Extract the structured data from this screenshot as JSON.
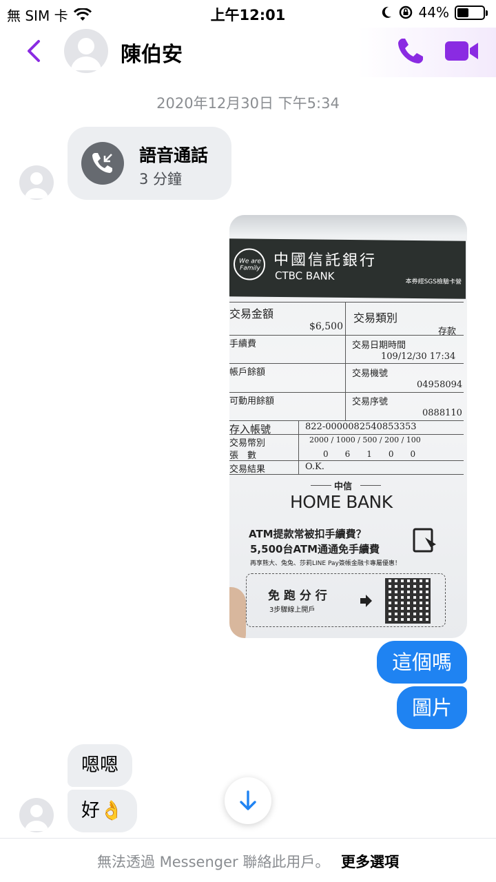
{
  "status_bar": {
    "carrier": "無 SIM 卡",
    "time": "上午12:01",
    "battery": "44%",
    "battery_level": 0.44
  },
  "header": {
    "contact_name": "陳伯安",
    "accent_color": "#8a2be2"
  },
  "conversation": {
    "timestamp": "2020年12月30日 下午5:34",
    "voice_call": {
      "title": "語音通話",
      "duration": "3 分鐘"
    },
    "receipt_photo": {
      "bank_name_zh": "中國信託銀行",
      "bank_name_en": "CTBC BANK",
      "banner_note": "本券經SGS檢驗卡營",
      "logo_text": "We are Family",
      "amount_label": "交易金額",
      "amount": "$6,500",
      "type_label": "交易類別",
      "type": "存款",
      "fee_label": "手續費",
      "datetime_label": "交易日期時間",
      "datetime": "109/12/30 17:34",
      "balance_label": "帳戶餘額",
      "machine_label": "交易機號",
      "machine": "04958094",
      "available_label": "可動用餘額",
      "serial_label": "交易序號",
      "serial": "0888110",
      "account_label": "存入帳號",
      "account": "822-0000082540853353",
      "currency_label": "交易幣別",
      "denominations": "2000 / 1000 / 500 / 200 / 100",
      "count_label": "張　數",
      "counts": "0　　6　　1　　0　　0",
      "result_label": "交易結果",
      "result": "O.K.",
      "divider_label": "中信",
      "homebank": "HOME BANK",
      "promo_line1": "ATM提款常被扣手續費？",
      "promo_line2": "5,500台ATM通通免手續費",
      "promo_line3": "再享熊大、兔兔、莎莉LINE Pay簽帳金融卡專屬優惠！",
      "promo_box_title": "免 跑 分 行",
      "promo_box_sub": "3步驟線上開戶"
    },
    "sent_messages": [
      "這個嗎",
      "圖片"
    ],
    "received_messages": [
      "嗯嗯",
      "好👌"
    ]
  },
  "footer": {
    "notice": "無法透過 Messenger 聯絡此用戶。",
    "more_options": "更多選項"
  }
}
